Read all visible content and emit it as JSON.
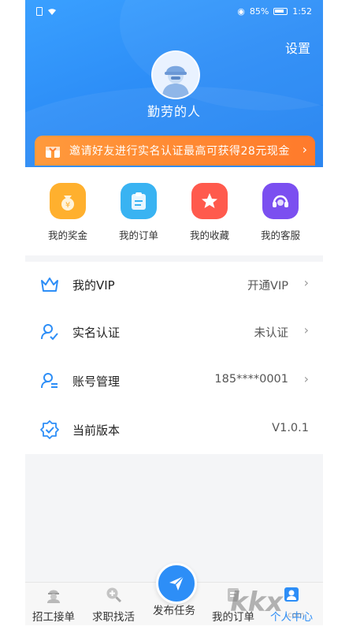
{
  "status_bar": {
    "battery": "85%",
    "time": "1:52"
  },
  "header": {
    "settings_label": "设置",
    "username": "勤劳的人"
  },
  "invite_banner": {
    "text": "邀请好友进行实名认证最高可获得28元现金",
    "arrow": "›"
  },
  "quick_actions": [
    {
      "label": "我的奖金",
      "icon": "money-bag-icon",
      "color": "#ffb02e"
    },
    {
      "label": "我的订单",
      "icon": "clipboard-icon",
      "color": "#39b3f2"
    },
    {
      "label": "我的收藏",
      "icon": "star-icon",
      "color": "#ff5a4d"
    },
    {
      "label": "我的客服",
      "icon": "headset-icon",
      "color": "#7b4ff0"
    }
  ],
  "menu": [
    {
      "label": "我的VIP",
      "value": "开通VIP",
      "icon": "crown-icon",
      "arrow": "›"
    },
    {
      "label": "实名认证",
      "value": "未认证",
      "icon": "user-check-icon",
      "arrow": "›"
    },
    {
      "label": "账号管理",
      "value": "185****0001",
      "icon": "user-manage-icon",
      "arrow": "›"
    },
    {
      "label": "当前版本",
      "value": "V1.0.1",
      "icon": "badge-check-icon"
    }
  ],
  "bottom_nav": [
    {
      "label": "招工接单",
      "icon": "worker-icon"
    },
    {
      "label": "求职找活",
      "icon": "search-plus-icon"
    },
    {
      "label": "发布任务",
      "icon": "paper-plane-icon"
    },
    {
      "label": "我的订单",
      "icon": "orders-icon"
    },
    {
      "label": "个人中心",
      "icon": "person-icon",
      "active": true
    }
  ],
  "colors": {
    "primary": "#2d8ef7",
    "banner": "#ff8a33",
    "background": "#f4f5f7"
  },
  "watermark": "kkx"
}
